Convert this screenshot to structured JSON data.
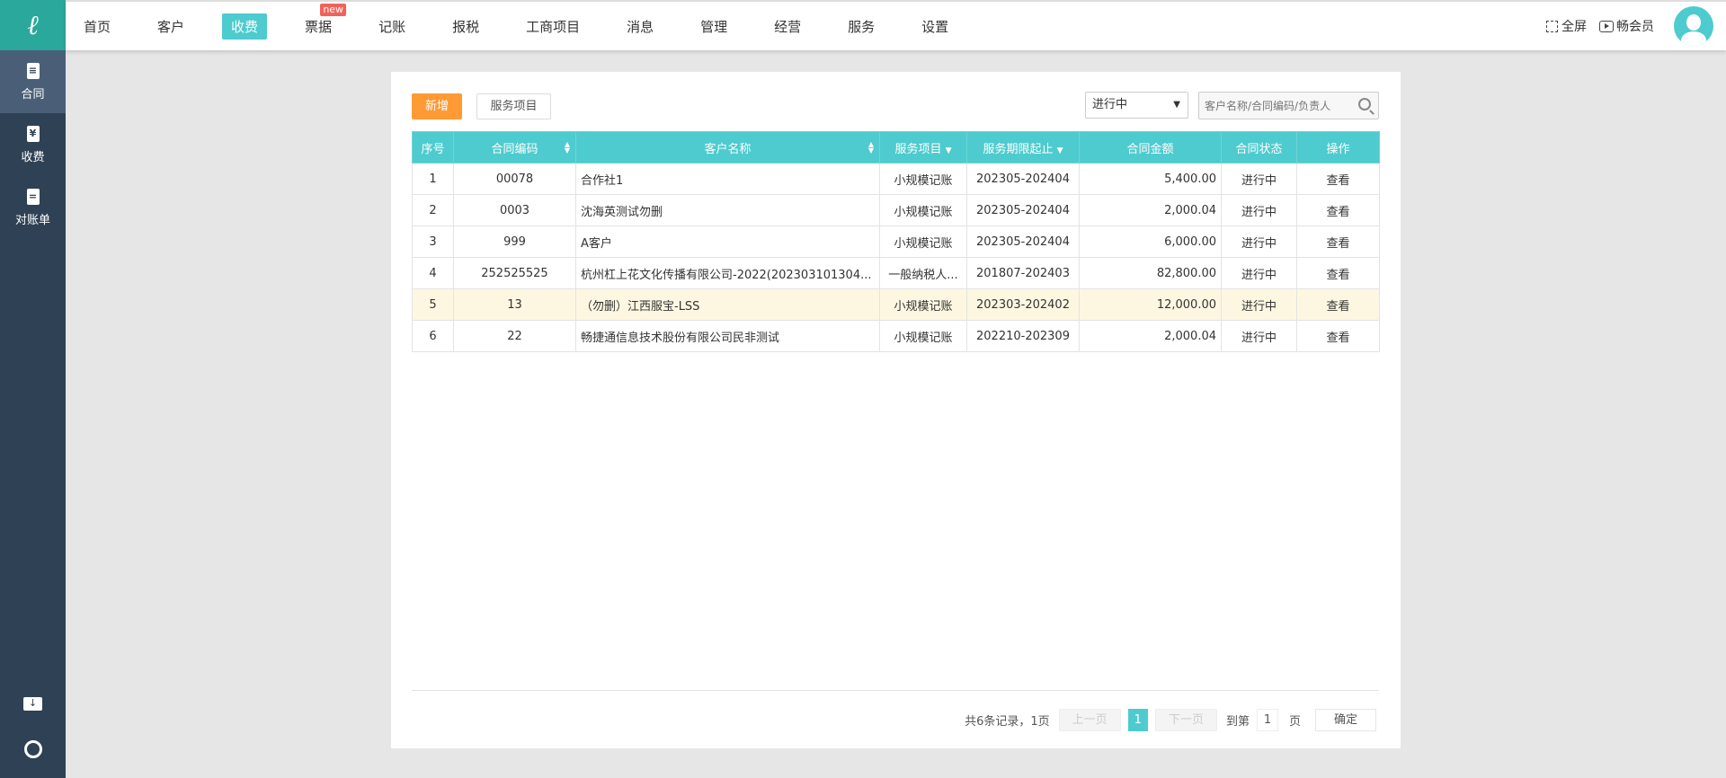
{
  "nav": {
    "items": [
      {
        "label": "首页"
      },
      {
        "label": "客户"
      },
      {
        "label": "收费",
        "active": true
      },
      {
        "label": "票据",
        "badge": "new"
      },
      {
        "label": "记账"
      },
      {
        "label": "报税"
      },
      {
        "label": "工商项目"
      },
      {
        "label": "消息"
      },
      {
        "label": "管理"
      },
      {
        "label": "经营"
      },
      {
        "label": "服务"
      },
      {
        "label": "设置"
      }
    ],
    "fullscreen": "全屏",
    "member": "畅会员"
  },
  "sidebar": {
    "items": [
      {
        "label": "合同",
        "icon": "contract-icon",
        "glyph": "≡"
      },
      {
        "label": "收费",
        "icon": "yen-icon",
        "glyph": "¥"
      },
      {
        "label": "对账单",
        "icon": "statement-icon",
        "glyph": "="
      }
    ]
  },
  "toolbar": {
    "add": "新增",
    "service": "服务项目",
    "status_select": "进行中",
    "search_placeholder": "客户名称/合同编码/负责人"
  },
  "table": {
    "headers": [
      "序号",
      "合同编码",
      "客户名称",
      "服务项目",
      "服务期限起止",
      "合同金额",
      "合同状态",
      "操作"
    ],
    "rows": [
      [
        "1",
        "00078",
        "合作社1",
        "小规模记账",
        "202305-202404",
        "5,400.00",
        "进行中",
        "查看"
      ],
      [
        "2",
        "0003",
        "沈海英测试勿删",
        "小规模记账",
        "202305-202404",
        "2,000.04",
        "进行中",
        "查看"
      ],
      [
        "3",
        "999",
        "A客户",
        "小规模记账",
        "202305-202404",
        "6,000.00",
        "进行中",
        "查看"
      ],
      [
        "4",
        "252525525",
        "杭州杠上花文化传播有限公司-2022(202303101304...",
        "一般纳税人...",
        "201807-202403",
        "82,800.00",
        "进行中",
        "查看"
      ],
      [
        "5",
        "13",
        "（勿删）江西服宝-LSS",
        "小规模记账",
        "202303-202402",
        "12,000.00",
        "进行中",
        "查看"
      ],
      [
        "6",
        "22",
        "畅捷通信息技术股份有限公司民非测试",
        "小规模记账",
        "202210-202309",
        "2,000.04",
        "进行中",
        "查看"
      ]
    ]
  },
  "pager": {
    "summary": "共6条记录，1页",
    "prev": "上一页",
    "current": "1",
    "next": "下一页",
    "goto": "到第",
    "page_input": "1",
    "page_unit": "页",
    "confirm": "确定"
  },
  "colors": {
    "accent": "#4ecbce",
    "orange": "#ff9a35",
    "sidebar": "#2f4154",
    "logo": "#2aa89b"
  }
}
